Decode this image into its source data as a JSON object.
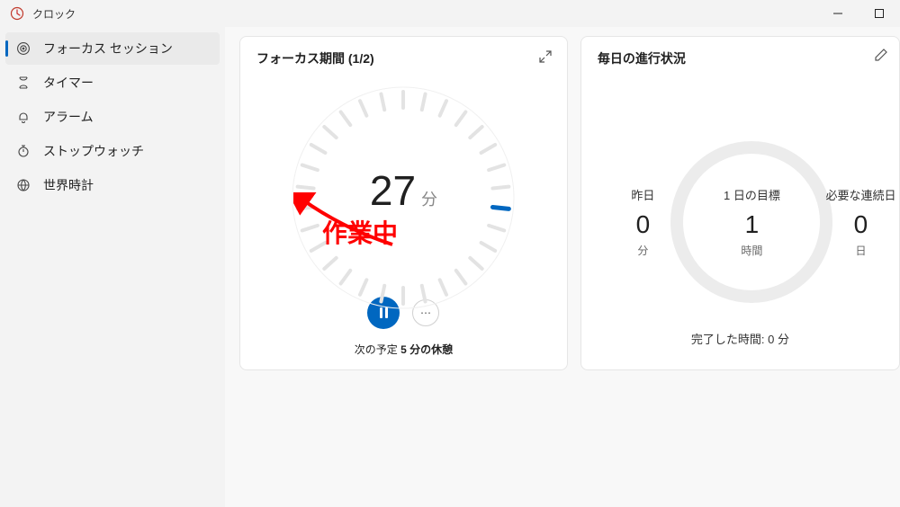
{
  "app": {
    "title": "クロック"
  },
  "sidebar": {
    "items": [
      {
        "label": "フォーカス セッション",
        "icon": "target-icon",
        "active": true
      },
      {
        "label": "タイマー",
        "icon": "hourglass-icon",
        "active": false
      },
      {
        "label": "アラーム",
        "icon": "bell-icon",
        "active": false
      },
      {
        "label": "ストップウォッチ",
        "icon": "stopwatch-icon",
        "active": false
      },
      {
        "label": "世界時計",
        "icon": "globe-icon",
        "active": false
      }
    ]
  },
  "focus": {
    "title": "フォーカス期間 (1/2)",
    "minutes": "27",
    "unit": "分",
    "next_label_prefix": "次の予定 ",
    "next_bold": "5 分の休憩"
  },
  "progress": {
    "title": "毎日の進行状況",
    "yesterday": {
      "label": "昨日",
      "value": "0",
      "unit": "分"
    },
    "goal": {
      "label": "1 日の目標",
      "value": "1",
      "unit": "時間"
    },
    "streak": {
      "label": "必要な連続日",
      "value": "0",
      "unit": "日"
    },
    "completed": "完了した時間: 0 分"
  },
  "annotation": {
    "text": "作業中"
  }
}
